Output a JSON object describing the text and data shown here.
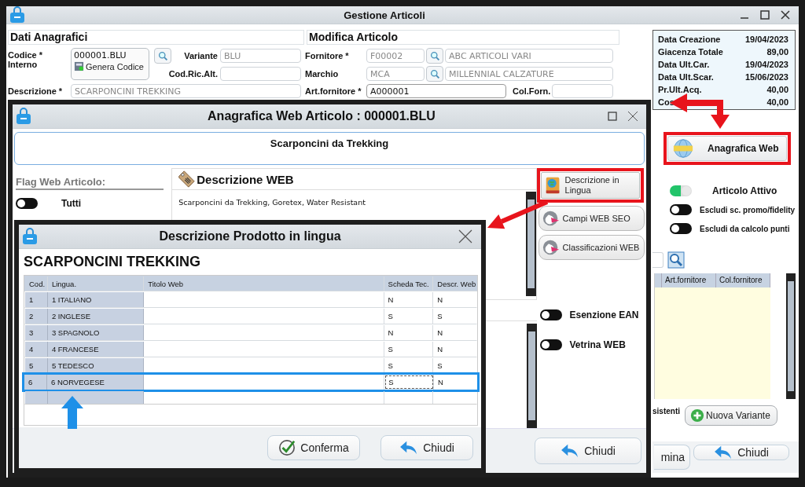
{
  "main_window": {
    "title": "Gestione Articoli",
    "headings": [
      "Dati Anagrafici",
      "Modifica Articolo"
    ],
    "codice": {
      "label": "Codice * Interno",
      "value": "000001.BLU",
      "button": "Genera Codice"
    },
    "variante": {
      "label": "Variante",
      "value": "BLU"
    },
    "cod_ric_alt": {
      "label": "Cod.Ric.Alt."
    },
    "descrizione": {
      "label": "Descrizione *",
      "value": "SCARPONCINI TREKKING"
    },
    "fornitore": {
      "label": "Fornitore *",
      "code": "F00002",
      "name": "ABC ARTICOLI VARI"
    },
    "marchio": {
      "label": "Marchio",
      "code": "MCA",
      "name": "MILLENNIAL CALZATURE"
    },
    "art_fornitore": {
      "label": "Art.fornitore *",
      "value": "A000001"
    },
    "col_forn": {
      "label": "Col.Forn."
    },
    "info": [
      {
        "label": "Data Creazione",
        "value": "19/04/2023"
      },
      {
        "label": "Giacenza Totale",
        "value": "89,00"
      },
      {
        "label": "Data Ult.Car.",
        "value": "19/04/2023"
      },
      {
        "label": "Data Ult.Scar.",
        "value": "15/06/2023"
      },
      {
        "label": "Pr.Ult.Acq.",
        "value": "40,00"
      },
      {
        "label": "Cos",
        "value": "40,00"
      }
    ],
    "web_button": "Anagrafica Web",
    "toggles": [
      {
        "label": "Articolo Attivo",
        "on": true
      },
      {
        "label": "Escludi sc. promo/fidelity",
        "on": false
      },
      {
        "label": "Escludi da calcolo punti",
        "on": false
      }
    ],
    "variants_columns": [
      "Art.fornitore",
      "Col.fornitore"
    ],
    "variants_caption": "sistenti",
    "new_variant_button": "Nuova Variante",
    "footer_buttons": [
      {
        "label": "mina",
        "kind": "plain"
      },
      {
        "label": "Chiudi",
        "kind": "back"
      }
    ]
  },
  "web_window": {
    "title": "Anagrafica Web Articolo : 000001.BLU",
    "subtitle": "Scarponcini da Trekking",
    "flags_heading": "Flag Web Articolo:",
    "flags": [
      {
        "label": "Tutti",
        "on": false
      }
    ],
    "description_heading": "Descrizione WEB",
    "description": "Scarponcini da Trekking, Goretex, Water Resistant",
    "side_buttons": [
      {
        "label": "Descrizione in Lingua",
        "kind": "book"
      },
      {
        "label": "Campi WEB SEO",
        "kind": "bird"
      },
      {
        "label": "Classificazioni WEB",
        "kind": "bird"
      }
    ],
    "toggles": [
      {
        "label": "Esenzione EAN",
        "on": false
      },
      {
        "label": "Vetrina WEB",
        "on": false
      }
    ],
    "close_button": "Chiudi"
  },
  "language_dialog": {
    "title": "Descrizione Prodotto in lingua",
    "heading": "SCARPONCINI TREKKING",
    "columns": [
      "Cod.",
      "Lingua.",
      "Titolo Web",
      "Scheda Tec.",
      "Descr. Web"
    ],
    "rows": [
      {
        "cod": "1",
        "lingua": "1 ITALIANO",
        "scheda": "N",
        "descr": "N",
        "selected": false
      },
      {
        "cod": "2",
        "lingua": "2 INGLESE",
        "scheda": "S",
        "descr": "S",
        "selected": false
      },
      {
        "cod": "3",
        "lingua": "3 SPAGNOLO",
        "scheda": "N",
        "descr": "N",
        "selected": false
      },
      {
        "cod": "4",
        "lingua": "4 FRANCESE",
        "scheda": "S",
        "descr": "N",
        "selected": false
      },
      {
        "cod": "5",
        "lingua": "5 TEDESCO",
        "scheda": "S",
        "descr": "S",
        "selected": false
      },
      {
        "cod": "6",
        "lingua": "6 NORVEGESE",
        "scheda": "S",
        "descr": "N",
        "selected": true
      }
    ],
    "buttons": [
      {
        "label": "Conferma",
        "kind": "confirm"
      },
      {
        "label": "Chiudi",
        "kind": "back"
      }
    ]
  }
}
